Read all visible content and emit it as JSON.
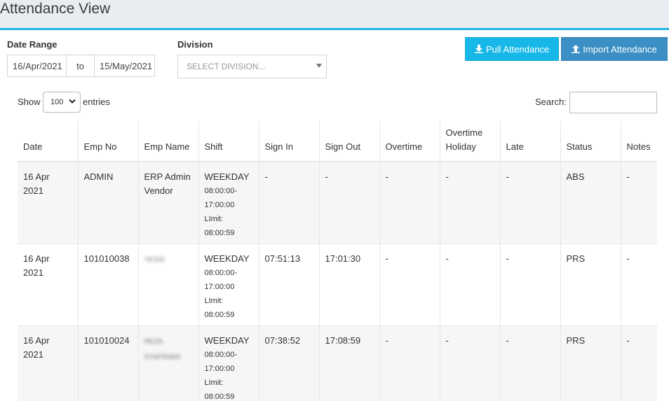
{
  "header": {
    "title": "Attendance View"
  },
  "filters": {
    "date_range_label": "Date Range",
    "date_from": "16/Apr/2021",
    "date_sep": "to",
    "date_to": "15/May/2021",
    "division_label": "Division",
    "division_placeholder": "SELECT DIVISION..."
  },
  "actions": {
    "pull_label": "Pull Attendance",
    "import_label": "Import Attendance"
  },
  "table_controls": {
    "show_label": "Show",
    "entries_value": "100",
    "entries_label": "entries",
    "search_label": "Search:"
  },
  "table": {
    "headers": [
      "Date",
      "Emp No",
      "Emp Name",
      "Shift",
      "Sign In",
      "Sign Out",
      "Overtime",
      "Overtime Holiday",
      "Late",
      "Status",
      "Notes"
    ],
    "rows": [
      {
        "date": "16 Apr 2021",
        "emp_no": "ADMIN",
        "emp_name": "ERP Admin Vendor",
        "shift_name": "WEEKDAY",
        "shift_start": "08:00:00-",
        "shift_end": "17:00:00",
        "shift_limit_label": "LImit:",
        "shift_limit": "08:00:59",
        "sign_in": "-",
        "sign_out": "-",
        "overtime": "-",
        "overtime_holiday": "-",
        "late": "-",
        "status": "ABS",
        "notes": "-"
      },
      {
        "date": "16 Apr 2021",
        "emp_no": "101010038",
        "emp_name": "YESSI",
        "shift_name": "WEEKDAY",
        "shift_start": "08:00:00-",
        "shift_end": "17:00:00",
        "shift_limit_label": "LImit:",
        "shift_limit": "08:00:59",
        "sign_in": "07:51:13",
        "sign_out": "17:01:30",
        "overtime": "-",
        "overtime_holiday": "-",
        "late": "-",
        "status": "PRS",
        "notes": "-"
      },
      {
        "date": "16 Apr 2021",
        "emp_no": "101010024",
        "emp_name": "REZA SYAFRIADI",
        "shift_name": "WEEKDAY",
        "shift_start": "08:00:00-",
        "shift_end": "17:00:00",
        "shift_limit_label": "LImit:",
        "shift_limit": "08:00:59",
        "sign_in": "07:38:52",
        "sign_out": "17:08:59",
        "overtime": "-",
        "overtime_holiday": "-",
        "late": "-",
        "status": "PRS",
        "notes": "-"
      }
    ]
  },
  "colors": {
    "accent": "#1eb4e6",
    "pull_button": "#17b8e8",
    "import_button": "#3b8fc4",
    "header_bg": "#e9edf2"
  },
  "icons": {
    "pull": "download-icon",
    "import": "upload-icon",
    "select_caret": "caret-down-icon"
  }
}
